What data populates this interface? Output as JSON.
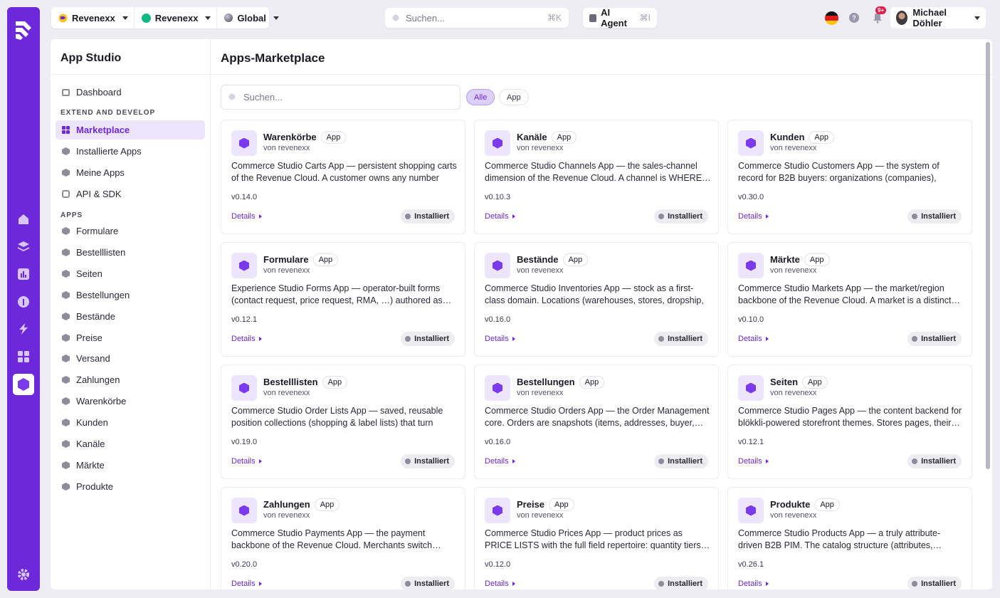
{
  "topbar": {
    "org1": "Revenexx",
    "org2": "Revenexx",
    "scope": "Global",
    "search_placeholder": "Suchen...",
    "search_shortcut": "⌘K",
    "agent_label": "AI Agent",
    "agent_shortcut": "⌘I",
    "notifications_badge": "9+",
    "user_name": "Michael Döhler"
  },
  "sidebar": {
    "title": "App Studio",
    "dashboard": "Dashboard",
    "section_extend": "EXTEND AND DEVELOP",
    "extend_items": [
      "Marketplace",
      "Installierte Apps",
      "Meine Apps",
      "API & SDK"
    ],
    "section_apps": "APPS",
    "app_items": [
      "Formulare",
      "Bestelllisten",
      "Seiten",
      "Bestellungen",
      "Bestände",
      "Preise",
      "Versand",
      "Zahlungen",
      "Warenkörbe",
      "Kunden",
      "Kanäle",
      "Märkte",
      "Produkte"
    ]
  },
  "main": {
    "title": "Apps-Marketplace",
    "search_placeholder": "Suchen...",
    "filter_all": "Alle",
    "filter_app": "App"
  },
  "card_common": {
    "tag": "App",
    "vendor": "von revenexx",
    "details": "Details",
    "status": "Installiert"
  },
  "cards": [
    {
      "name": "Warenkörbe",
      "desc": "Commerce Studio Carts App — persistent shopping carts of the Revenue Cloud. A customer owns any number of…",
      "version": "v0.14.0"
    },
    {
      "name": "Kanäle",
      "desc": "Commerce Studio Channels App — the sales-channel dimension of the Revenue Cloud. A channel is WHERE…",
      "version": "v0.10.3"
    },
    {
      "name": "Kunden",
      "desc": "Commerce Studio Customers App — the system of record for B2B buyers: organizations (companies), contacts…",
      "version": "v0.30.0"
    },
    {
      "name": "Formulare",
      "desc": "Experience Studio Forms App — operator-built forms (contact request, price request, RMA, …) authored as…",
      "version": "v0.12.1"
    },
    {
      "name": "Bestände",
      "desc": "Commerce Studio Inventories App — stock as a first-class domain. Locations (warehouses, stores, dropship, virtual…",
      "version": "v0.16.0"
    },
    {
      "name": "Märkte",
      "desc": "Commerce Studio Markets App — the market/region backbone of the Revenue Cloud. A market is a distinct…",
      "version": "v0.10.0"
    },
    {
      "name": "Bestelllisten",
      "desc": "Commerce Studio Order Lists App — saved, reusable position collections (shopping & label lists) that turn bac…",
      "version": "v0.19.0"
    },
    {
      "name": "Bestellungen",
      "desc": "Commerce Studio Orders App — the Order Management core. Orders are snapshots (items, addresses, buyer,…",
      "version": "v0.16.0"
    },
    {
      "name": "Seiten",
      "desc": "Commerce Studio Pages App — the content backend for blökkli-powered storefront themes. Stores pages, their…",
      "version": "v0.12.1"
    },
    {
      "name": "Zahlungen",
      "desc": "Commerce Studio Payments App — the payment backbone of the Revenue Cloud. Merchants switch…",
      "version": "v0.20.0"
    },
    {
      "name": "Preise",
      "desc": "Commerce Studio Prices App — product prices as PRICE LISTS with the full field repertoire: quantity tiers…",
      "version": "v0.12.0"
    },
    {
      "name": "Produkte",
      "desc": "Commerce Studio Products App — a truly attribute-driven B2B PIM. The catalog structure (attributes,…",
      "version": "v0.26.1"
    }
  ]
}
